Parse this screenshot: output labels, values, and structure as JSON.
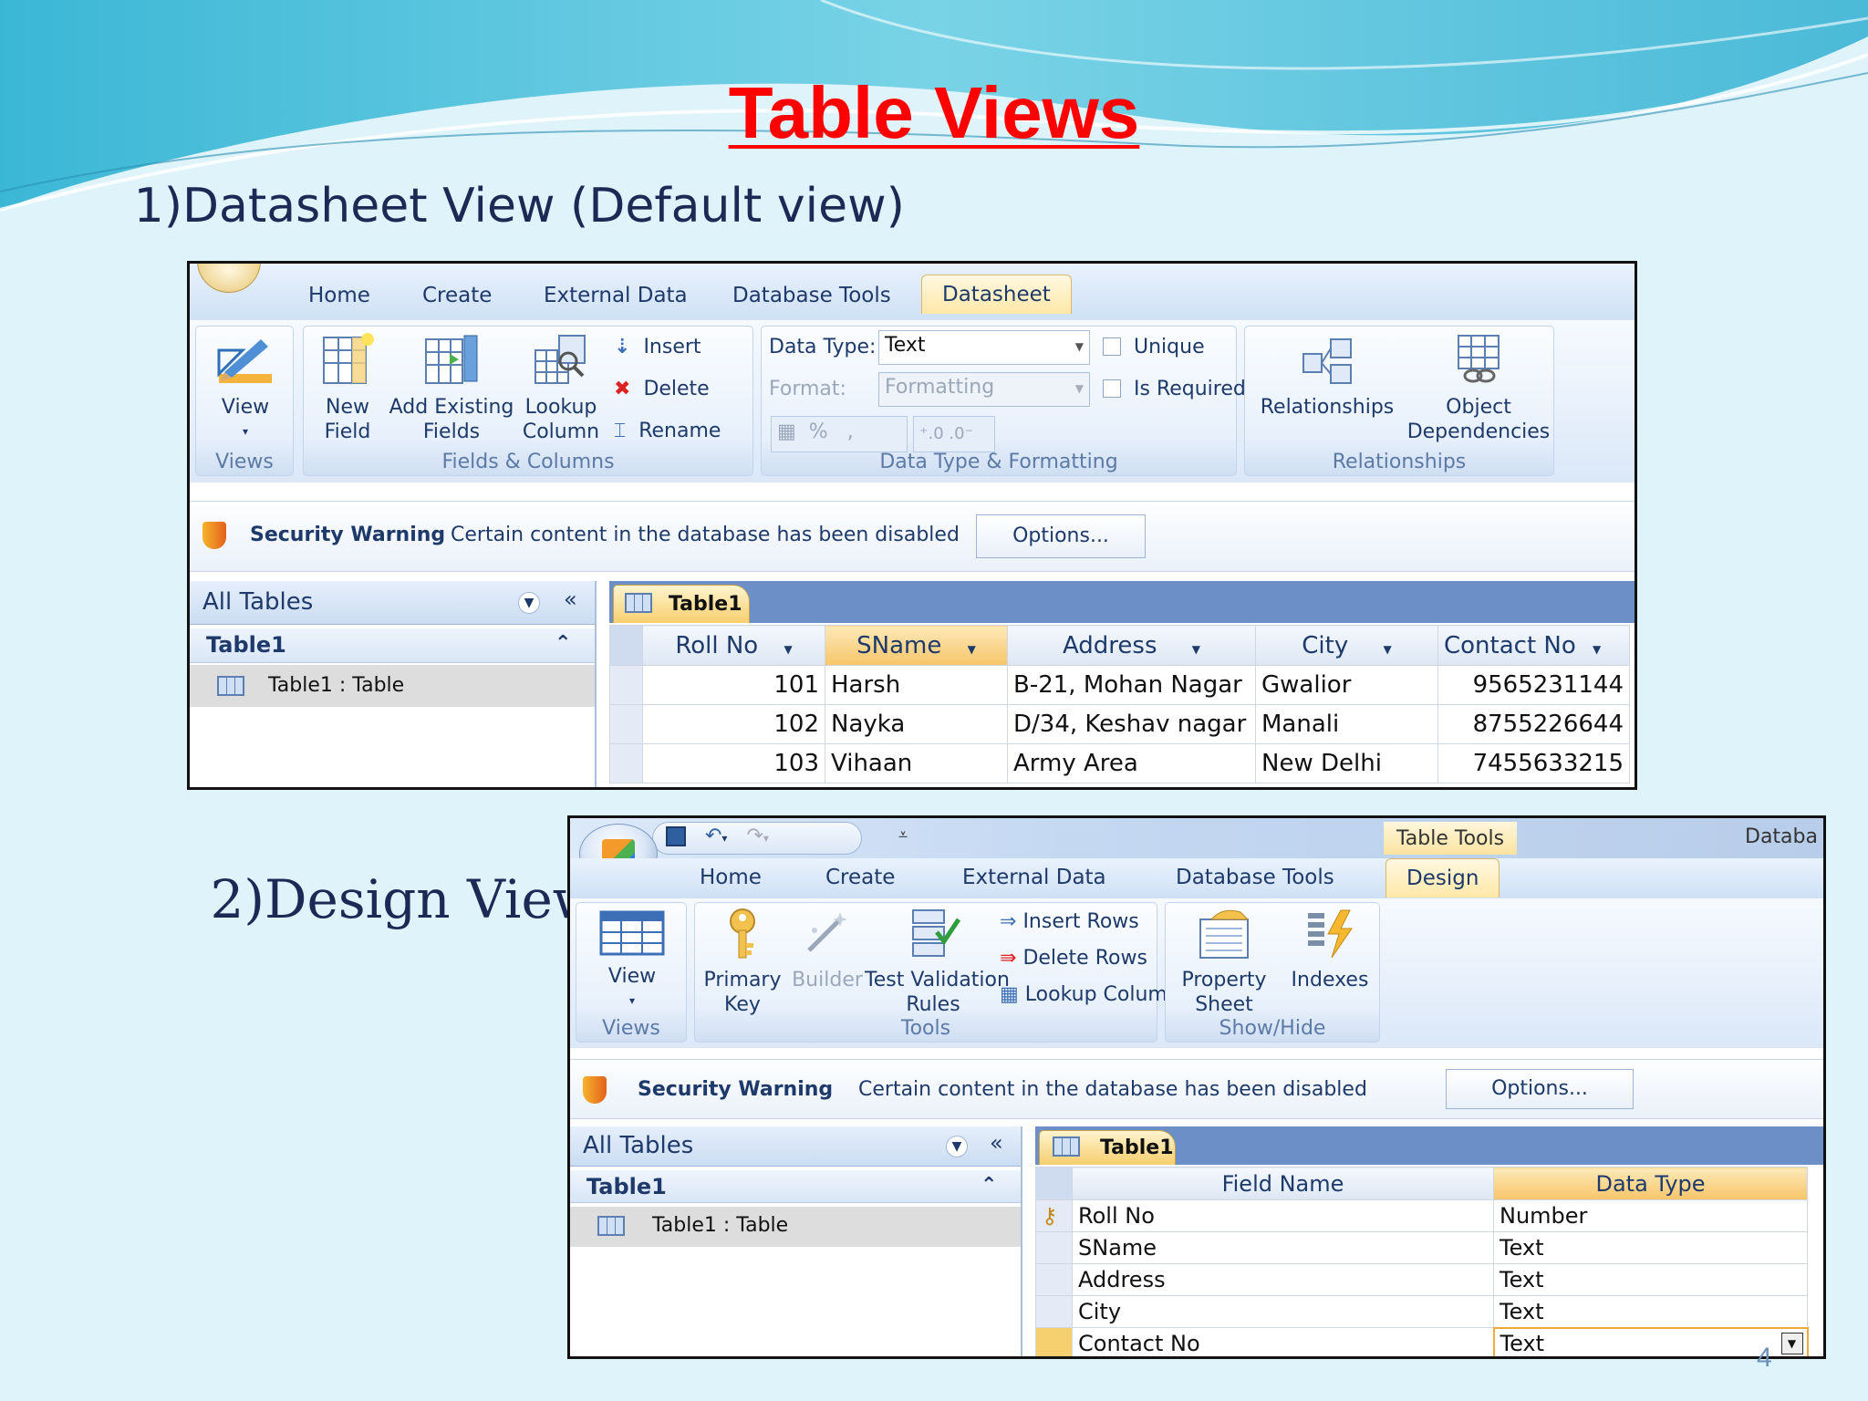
{
  "slide": {
    "title": "Table Views",
    "item1": {
      "num": "1)",
      "text": "Datasheet View (Default view)"
    },
    "item2": {
      "num": "2)",
      "text": "Design View"
    },
    "page_number": "4"
  },
  "datasheet": {
    "tabs": [
      "Home",
      "Create",
      "External Data",
      "Database Tools",
      "Datasheet"
    ],
    "active_tab": "Datasheet",
    "groups": {
      "views": {
        "name": "Views",
        "view": "View"
      },
      "fields": {
        "name": "Fields & Columns",
        "new_field": [
          "New",
          "Field"
        ],
        "add_existing": [
          "Add Existing",
          "Fields"
        ],
        "lookup": [
          "Lookup",
          "Column"
        ],
        "insert": "Insert",
        "delete": "Delete",
        "rename": "Rename"
      },
      "format": {
        "name": "Data Type & Formatting",
        "data_type_label": "Data Type:",
        "data_type_value": "Text",
        "format_label": "Format:",
        "format_value": "Formatting",
        "unique": "Unique",
        "is_required": "Is Required",
        "percent": "%"
      },
      "relationships": {
        "name": "Relationships",
        "relationships": "Relationships",
        "object_dependencies": [
          "Object",
          "Dependencies"
        ]
      }
    },
    "security": {
      "title": "Security Warning",
      "message": "Certain content in the database has been disabled",
      "options": "Options..."
    },
    "nav": {
      "header": "All Tables",
      "group": "Table1",
      "item": "Table1 : Table"
    },
    "doc_tab": "Table1",
    "columns": [
      "Roll No",
      "SName",
      "Address",
      "City",
      "Contact No"
    ],
    "rows": [
      [
        "101",
        "Harsh",
        "B-21, Mohan Nagar",
        "Gwalior",
        "9565231144"
      ],
      [
        "102",
        "Nayka",
        "D/34, Keshav nagar",
        "Manali",
        "8755226644"
      ],
      [
        "103",
        "Vihaan",
        "Army Area",
        "New Delhi",
        "7455633215"
      ]
    ]
  },
  "design": {
    "context_label": "Table Tools",
    "app_title": "Databa",
    "tabs": [
      "Home",
      "Create",
      "External Data",
      "Database Tools",
      "Design"
    ],
    "active_tab": "Design",
    "groups": {
      "views": {
        "name": "Views",
        "view": "View"
      },
      "tools": {
        "name": "Tools",
        "primary_key": [
          "Primary",
          "Key"
        ],
        "builder": "Builder",
        "test_rules": [
          "Test Validation",
          "Rules"
        ],
        "insert_rows": "Insert Rows",
        "delete_rows": "Delete Rows",
        "lookup_column": "Lookup Column"
      },
      "showhide": {
        "name": "Show/Hide",
        "property_sheet": [
          "Property",
          "Sheet"
        ],
        "indexes": "Indexes"
      }
    },
    "security": {
      "title": "Security Warning",
      "message": "Certain content in the database has been disabled",
      "options": "Options..."
    },
    "nav": {
      "header": "All Tables",
      "group": "Table1",
      "item": "Table1 : Table"
    },
    "doc_tab": "Table1",
    "columns": [
      "Field Name",
      "Data Type"
    ],
    "rows": [
      [
        "Roll No",
        "Number"
      ],
      [
        "SName",
        "Text"
      ],
      [
        "Address",
        "Text"
      ],
      [
        "City",
        "Text"
      ],
      [
        "Contact No",
        "Text"
      ]
    ]
  }
}
